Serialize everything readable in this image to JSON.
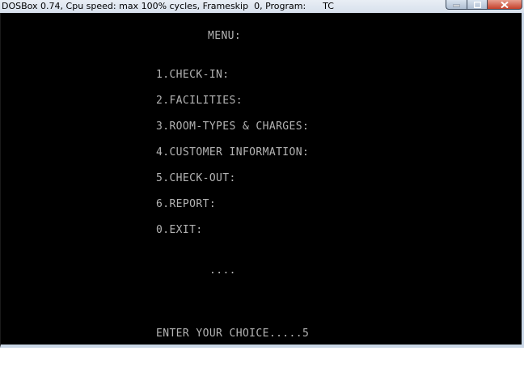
{
  "window": {
    "title": "DOSBox 0.74, Cpu speed: max 100% cycles, Frameskip  0, Program:      TC"
  },
  "screen": {
    "menu_title": "MENU:",
    "items": [
      "1.CHECK-IN:",
      "2.FACILITIES:",
      "3.ROOM-TYPES & CHARGES:",
      "4.CUSTOMER INFORMATION:",
      "5.CHECK-OUT:",
      "6.REPORT:",
      "0.EXIT:"
    ],
    "ellipsis": "....",
    "prompt": "ENTER YOUR CHOICE.....5"
  },
  "colors": {
    "screen_background": "#000000",
    "screen_text": "#b4b4b4",
    "close_button": "#c4402b"
  },
  "icons": {
    "minimize": "minimize-icon",
    "maximize": "maximize-icon",
    "close": "close-icon"
  }
}
